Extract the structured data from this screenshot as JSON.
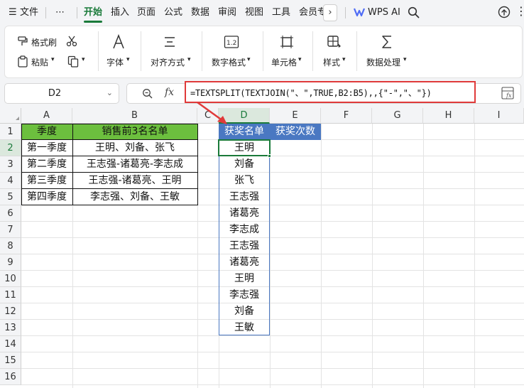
{
  "menu": {
    "file_label": "文件",
    "more_label": "⋯",
    "tabs": [
      "开始",
      "插入",
      "页面",
      "公式",
      "数据",
      "审阅",
      "视图",
      "工具",
      "会员专"
    ],
    "active_tab": "开始",
    "wps_ai_label": "WPS AI"
  },
  "ribbon": {
    "format_painter": "格式刷",
    "paste": "粘贴",
    "font": "字体",
    "alignment": "对齐方式",
    "number_format": "数字格式",
    "cell": "单元格",
    "style": "样式",
    "data_processing": "数据处理"
  },
  "formula_bar": {
    "name_box": "D2",
    "fx": "fx",
    "formula": "=TEXTSPLIT(TEXTJOIN(\"、\",TRUE,B2:B5),,{\"-\",\"、\"})"
  },
  "sheet": {
    "columns": [
      "A",
      "B",
      "C",
      "D",
      "E",
      "F",
      "G",
      "H",
      "I"
    ],
    "rows": [
      "1",
      "2",
      "3",
      "4",
      "5",
      "6",
      "7",
      "8",
      "9",
      "10",
      "11",
      "12",
      "13",
      "14",
      "15",
      "16"
    ],
    "selected_cell": "D2",
    "table1": {
      "headers": [
        "季度",
        "销售前3名名单"
      ],
      "rows": [
        [
          "第一季度",
          "王明、刘备、张飞"
        ],
        [
          "第二季度",
          "王志强-诸葛亮-李志成"
        ],
        [
          "第三季度",
          "王志强-诸葛亮、王明"
        ],
        [
          "第四季度",
          "李志强、刘备、王敏"
        ]
      ]
    },
    "table2": {
      "headers": [
        "获奖名单",
        "获奖次数"
      ],
      "names": [
        "王明",
        "刘备",
        "张飞",
        "王志强",
        "诸葛亮",
        "李志成",
        "王志强",
        "诸葛亮",
        "王明",
        "李志强",
        "刘备",
        "王敏"
      ]
    }
  },
  "colors": {
    "accent": "#1a7a3a",
    "header_green": "#6cbf3e",
    "header_blue": "#4a78c2",
    "highlight_red": "#e03a3a"
  }
}
